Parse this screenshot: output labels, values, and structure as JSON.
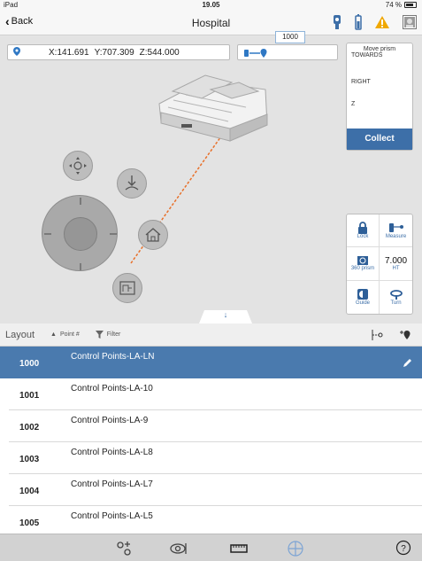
{
  "status": {
    "device": "iPad",
    "time": "19.05",
    "battery": "74 %"
  },
  "nav": {
    "back_label": "Back",
    "title": "Hospital"
  },
  "coords": {
    "x": "X:141.691",
    "y": "Y:707.309",
    "z": "Z:544.000"
  },
  "tooltip": "1000",
  "prism_panel": {
    "title": "Move prism",
    "direction": "TOWARDS",
    "lateral": "RIGHT",
    "vertical": "Z",
    "collect_label": "Collect"
  },
  "tools": {
    "lock": "Lock",
    "measure": "Measure",
    "prism": "360 prism",
    "ht_value": "7.000",
    "ht": "HT",
    "guide": "Guide",
    "turn": "Turn"
  },
  "layout": {
    "title": "Layout",
    "sort_label": "Point #",
    "filter_label": "Filter"
  },
  "points": [
    {
      "num": "1000",
      "name": "Control Points-LA-LN"
    },
    {
      "num": "1001",
      "name": "Control Points-LA-10"
    },
    {
      "num": "1002",
      "name": "Control Points-LA-9"
    },
    {
      "num": "1003",
      "name": "Control Points-LA-L8"
    },
    {
      "num": "1004",
      "name": "Control Points-LA-L7"
    },
    {
      "num": "1005",
      "name": "Control Points-LA-L5"
    }
  ],
  "colors": {
    "accent": "#3d6fa8",
    "selected_row": "#4a7aae",
    "warning": "#f0a800",
    "laser": "#e8702a"
  },
  "icons": {
    "nav": [
      "robot-total-station-icon",
      "instrument-battery-icon",
      "warning-icon",
      "user-icon"
    ],
    "toolbar": [
      "survey-points-icon",
      "camera-view-icon",
      "tape-measure-icon",
      "crosshair-icon",
      "help-icon"
    ]
  }
}
